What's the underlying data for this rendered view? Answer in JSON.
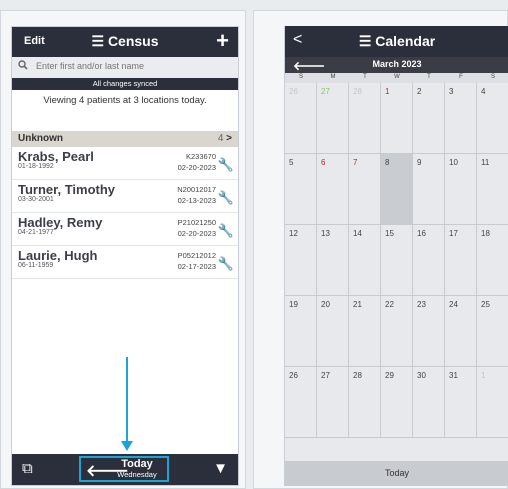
{
  "census": {
    "edit_label": "Edit",
    "title": "Census",
    "title_icon": "list-icon",
    "search_placeholder": "Enter first and/or last name",
    "sync_status": "All changes synced",
    "summary": "Viewing 4 patients at 3 locations today.",
    "group": {
      "label": "Unknown",
      "count": "4"
    },
    "patients": [
      {
        "name": "Krabs, Pearl",
        "dob": "01-18-1992",
        "mrn": "K233670",
        "date": "02-20-2023"
      },
      {
        "name": "Turner, Timothy",
        "dob": "03-30-2001",
        "mrn": "N20012017",
        "date": "02-13-2023"
      },
      {
        "name": "Hadley, Remy",
        "dob": "04-21-1977",
        "mrn": "P21021250",
        "date": "02-20-2023"
      },
      {
        "name": "Laurie, Hugh",
        "dob": "06-11-1959",
        "mrn": "P05212012",
        "date": "02-17-2023"
      }
    ],
    "footer": {
      "today_label": "Today",
      "today_sub": "Wednesday"
    },
    "colors": {
      "header": "#2b2f3b",
      "accent": "#1ea3d6"
    }
  },
  "calendar": {
    "title": "Calendar",
    "month": "March 2023",
    "days_of_week": [
      "S",
      "M",
      "T",
      "W",
      "T",
      "F",
      "S"
    ],
    "weeks": [
      [
        "26",
        "27",
        "28",
        "1",
        "2",
        "3",
        "4"
      ],
      [
        "5",
        "6",
        "7",
        "8",
        "9",
        "10",
        "11"
      ],
      [
        "12",
        "13",
        "14",
        "15",
        "16",
        "17",
        "18"
      ],
      [
        "19",
        "20",
        "21",
        "22",
        "23",
        "24",
        "25"
      ],
      [
        "26",
        "27",
        "28",
        "29",
        "30",
        "31",
        "1"
      ]
    ],
    "selected_day": "8",
    "footer_label": "Today"
  }
}
